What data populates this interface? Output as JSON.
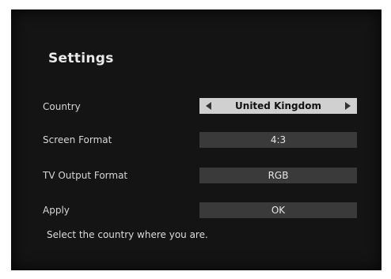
{
  "header": {
    "title": "Settings"
  },
  "rows": [
    {
      "label": "Country",
      "value": "United Kingdom"
    },
    {
      "label": "Screen Format",
      "value": "4:3"
    },
    {
      "label": "TV Output Format",
      "value": "RGB"
    },
    {
      "label": "Apply",
      "value": "OK"
    }
  ],
  "help_text": "Select the country where you are.",
  "colors": {
    "background": "#141414",
    "field": "#3a3a3a",
    "selected_field": "#d0d0d0"
  }
}
